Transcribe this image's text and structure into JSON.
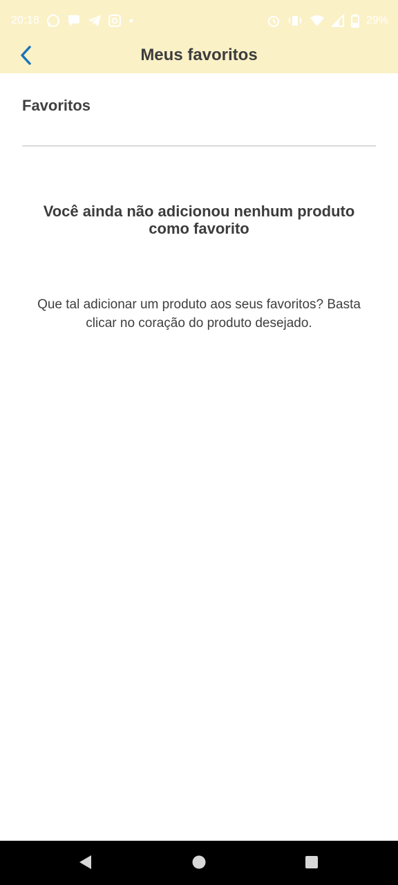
{
  "status_bar": {
    "time": "20:18",
    "battery": "29%",
    "left_icons": [
      "whatsapp-icon",
      "chat-bubble-icon",
      "telegram-icon",
      "instagram-icon",
      "dot-icon"
    ],
    "right_icons": [
      "alarm-icon",
      "vibrate-icon",
      "wifi-icon",
      "signal-icon",
      "battery-icon"
    ]
  },
  "app_bar": {
    "title": "Meus favoritos",
    "back_icon": "chevron-left-icon",
    "accent_color": "#1a73b8",
    "background_color": "#fbf1c7"
  },
  "content": {
    "section_title": "Favoritos",
    "empty_title": "Você ainda não adicionou nenhum produto como favorito",
    "empty_text": "Que tal adicionar um produto aos seus favoritos? Basta clicar no coração do produto desejado."
  },
  "nav_bar": {
    "buttons": [
      "back-triangle-icon",
      "home-circle-icon",
      "recents-square-icon"
    ]
  }
}
